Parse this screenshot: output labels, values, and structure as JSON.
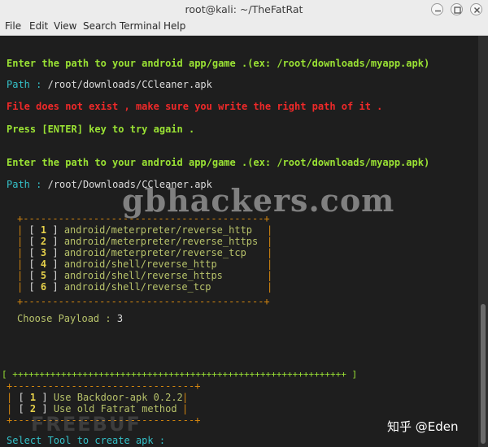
{
  "window": {
    "title": "root@kali: ~/TheFatRat",
    "controls": [
      "minimize-icon",
      "maximize-icon",
      "close-icon"
    ]
  },
  "menu": [
    "File",
    "Edit",
    "View",
    "Search",
    "Terminal",
    "Help"
  ],
  "terminal": {
    "prompt1": "Enter the path to your android app/game .(ex: /root/downloads/myapp.apk)",
    "path_label": "Path",
    "path_sep": " : ",
    "path1": "/root/downloads/CCleaner.apk",
    "error": "File does not exist , make sure you write the right path of it .",
    "press_enter": "Press [ENTER] key to try again .",
    "prompt2": "Enter the path to your android app/game .(ex: /root/downloads/myapp.apk)",
    "path2": "/root/Downloads/CCleaner.apk",
    "payload_border": "+-----------------------------------------+",
    "payloads": [
      {
        "num": "1",
        "label": "android/meterpreter/reverse_http"
      },
      {
        "num": "2",
        "label": "android/meterpreter/reverse_https"
      },
      {
        "num": "3",
        "label": "android/meterpreter/reverse_tcp"
      },
      {
        "num": "4",
        "label": "android/shell/reverse_http"
      },
      {
        "num": "5",
        "label": "android/shell/reverse_https"
      },
      {
        "num": "6",
        "label": "android/shell/reverse_tcp"
      }
    ],
    "choose_label": "Choose Payload : ",
    "choose_value": "3",
    "plus_line": "[ ++++++++++++++++++++++++++++++++++++++++++++++++++++++++++++++ ]",
    "tool_border": "+-------------------------------+",
    "tools": [
      {
        "num": "1",
        "label": "Use Backdoor-apk 0.2.2"
      },
      {
        "num": "2",
        "label": "Use old Fatrat method"
      }
    ],
    "select_prompt": "Select Tool to create apk : "
  },
  "watermarks": {
    "main": "gbhackers.com",
    "corner": "知乎 @Eden",
    "faded": "FREEBUF"
  },
  "colors": {
    "green": "#9ae234",
    "red": "#ef2929",
    "cyan": "#34c0c8",
    "orange": "#d4860e",
    "yellow": "#e5d04a",
    "background": "#1e1e1e"
  }
}
